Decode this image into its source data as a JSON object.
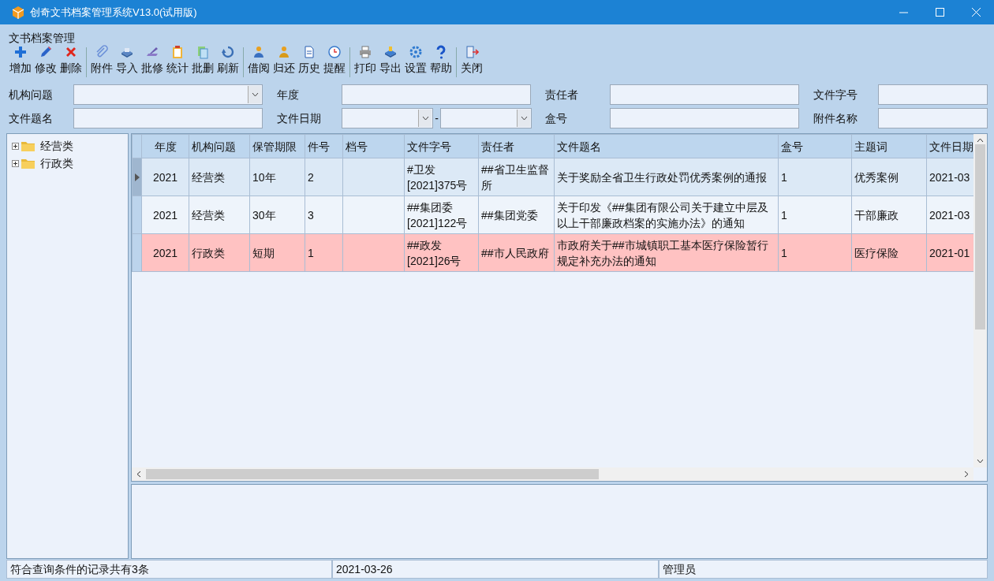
{
  "window": {
    "title": "创奇文书档案管理系统V13.0(试用版)"
  },
  "menu_title": "文书档案管理",
  "toolbar": [
    [
      {
        "label": "增加"
      },
      {
        "label": "修改"
      },
      {
        "label": "删除"
      }
    ],
    [
      {
        "label": "附件"
      },
      {
        "label": "导入"
      },
      {
        "label": "批修"
      },
      {
        "label": "统计"
      },
      {
        "label": "批删"
      },
      {
        "label": "刷新"
      }
    ],
    [
      {
        "label": "借阅"
      },
      {
        "label": "归还"
      },
      {
        "label": "历史"
      },
      {
        "label": "提醒"
      }
    ],
    [
      {
        "label": "打印"
      },
      {
        "label": "导出"
      },
      {
        "label": "设置"
      },
      {
        "label": "帮助"
      }
    ],
    [
      {
        "label": "关闭"
      }
    ]
  ],
  "filters": [
    [
      {
        "label": "机构问题",
        "kind": "select"
      },
      {
        "label": "年度",
        "kind": "text"
      },
      {
        "label": "责任者",
        "kind": "text"
      },
      {
        "label": "文件字号",
        "kind": "text"
      }
    ],
    [
      {
        "label": "文件题名",
        "kind": "text"
      },
      {
        "label": "文件日期",
        "kind": "daterange",
        "separator": "-"
      },
      {
        "label": "盒号",
        "kind": "text"
      },
      {
        "label": "附件名称",
        "kind": "text"
      }
    ]
  ],
  "tree": [
    {
      "label": "经营类",
      "expanded": false
    },
    {
      "label": "行政类",
      "expanded": false
    }
  ],
  "table": {
    "columns": [
      "年度",
      "机构问题",
      "保管期限",
      "件号",
      "档号",
      "文件字号",
      "责任者",
      "文件题名",
      "盒号",
      "主题词",
      "文件日期"
    ],
    "rows": [
      {
        "selected": true,
        "highlighted": false,
        "cells": [
          "2021",
          "经营类",
          "10年",
          "2",
          "",
          "#卫发[2021]375号",
          "##省卫生监督所",
          "关于奖励全省卫生行政处罚优秀案例的通报",
          "1",
          "优秀案例",
          "2021-03"
        ]
      },
      {
        "selected": false,
        "highlighted": false,
        "cells": [
          "2021",
          "经营类",
          "30年",
          "3",
          "",
          "##集团委[2021]122号",
          "##集团党委",
          "关于印发《##集团有限公司关于建立中层及以上干部廉政档案的实施办法》的通知",
          "1",
          "干部廉政",
          "2021-03"
        ]
      },
      {
        "selected": false,
        "highlighted": true,
        "cells": [
          "2021",
          "行政类",
          "短期",
          "1",
          "",
          "##政发[2021]26号",
          "##市人民政府",
          "市政府关于##市城镇职工基本医疗保险暂行规定补充办法的通知",
          "1",
          "医疗保险",
          "2021-01"
        ]
      }
    ]
  },
  "status_bar": [
    "符合查询条件的记录共有3条",
    "2021-03-26",
    "管理员"
  ]
}
